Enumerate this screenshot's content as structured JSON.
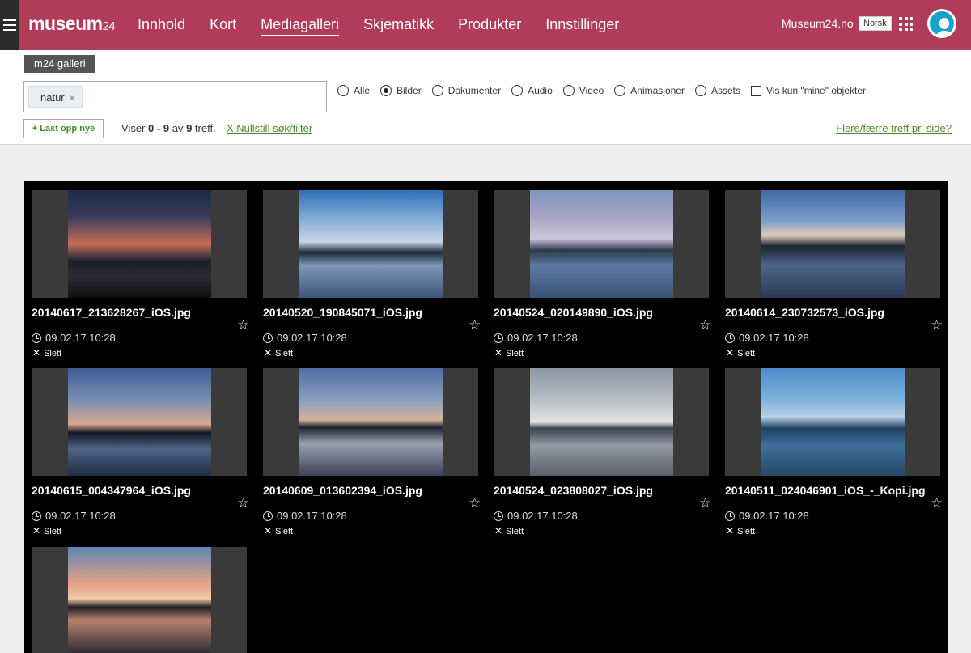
{
  "topbar": {
    "logo_main": "museum",
    "logo_suffix": "24",
    "nav": [
      {
        "label": "Innhold"
      },
      {
        "label": "Kort"
      },
      {
        "label": "Mediagalleri"
      },
      {
        "label": "Skjematikk"
      },
      {
        "label": "Produkter"
      },
      {
        "label": "Innstillinger"
      }
    ],
    "active_nav": "Mediagalleri",
    "site_link": "Museum24.no",
    "language": "Norsk",
    "brand_color": "#b13c5a"
  },
  "panel": {
    "gallery_tag": "m24 galleri",
    "search_chip": "natur",
    "chip_remove": "×",
    "filters": [
      {
        "label": "Alle",
        "type": "radio",
        "checked": false
      },
      {
        "label": "Bilder",
        "type": "radio",
        "checked": true
      },
      {
        "label": "Dokumenter",
        "type": "radio",
        "checked": false
      },
      {
        "label": "Audio",
        "type": "radio",
        "checked": false
      },
      {
        "label": "Video",
        "type": "radio",
        "checked": false
      },
      {
        "label": "Animasjoner",
        "type": "radio",
        "checked": false
      },
      {
        "label": "Assets",
        "type": "radio",
        "checked": false
      },
      {
        "label": "Vis kun \"mine\" objekter",
        "type": "checkbox",
        "checked": false
      }
    ],
    "upload_button": "+ Last opp nye",
    "results": {
      "prefix": "Viser",
      "from": "0",
      "dash": "-",
      "to": "9",
      "of": "av",
      "total": "9",
      "suffix": "treff."
    },
    "reset_link": "X Nullstill søk/filter",
    "perpage_link": "Flere/færre treff pr. side?",
    "link_color": "#4a8a2a"
  },
  "gallery": {
    "items": [
      {
        "filename": "20140617_213628267_iOS.jpg",
        "date": "09.02.17 10:28",
        "delete_label": "Slett"
      },
      {
        "filename": "20140520_190845071_iOS.jpg",
        "date": "09.02.17 10:28",
        "delete_label": "Slett"
      },
      {
        "filename": "20140524_020149890_iOS.jpg",
        "date": "09.02.17 10:28",
        "delete_label": "Slett"
      },
      {
        "filename": "20140614_230732573_iOS.jpg",
        "date": "09.02.17 10:28",
        "delete_label": "Slett"
      },
      {
        "filename": "20140615_004347964_iOS.jpg",
        "date": "09.02.17 10:28",
        "delete_label": "Slett"
      },
      {
        "filename": "20140609_013602394_iOS.jpg",
        "date": "09.02.17 10:28",
        "delete_label": "Slett"
      },
      {
        "filename": "20140524_023808027_iOS.jpg",
        "date": "09.02.17 10:28",
        "delete_label": "Slett"
      },
      {
        "filename": "20140511_024046901_iOS_-_Kopi.jpg",
        "date": "09.02.17 10:28",
        "delete_label": "Slett"
      },
      {
        "filename": "",
        "date": "",
        "delete_label": ""
      }
    ],
    "star_icon": "star-outline-icon",
    "clock_icon": "clock-icon",
    "delete_icon": "close-icon"
  }
}
